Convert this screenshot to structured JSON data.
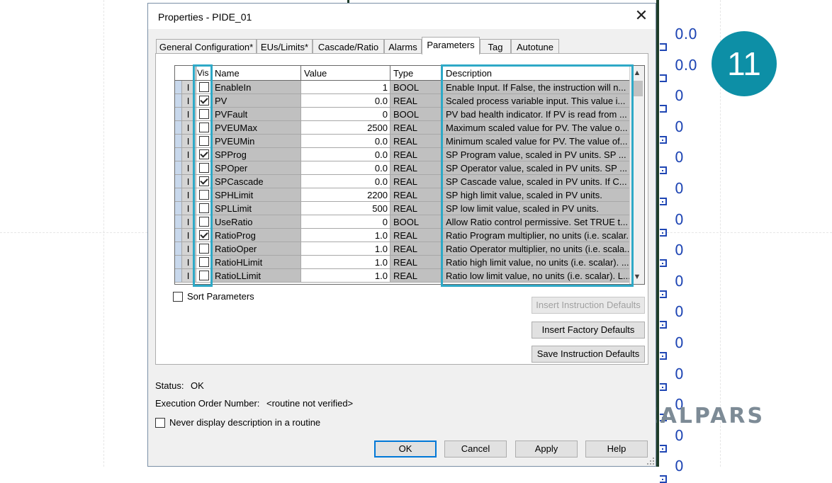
{
  "dialog": {
    "title": "Properties - PIDE_01",
    "close_glyph": "✕",
    "tabs": [
      {
        "label": "General Configuration*",
        "active": false
      },
      {
        "label": "EUs/Limits*",
        "active": false
      },
      {
        "label": "Cascade/Ratio",
        "active": false
      },
      {
        "label": "Alarms",
        "active": false
      },
      {
        "label": "Parameters",
        "active": true
      },
      {
        "label": "Tag",
        "active": false
      },
      {
        "label": "Autotune",
        "active": false
      }
    ],
    "grid": {
      "headers": {
        "vis": "Vis",
        "name": "Name",
        "value": "Value",
        "type": "Type",
        "description": "Description"
      },
      "rows": [
        {
          "io": "I",
          "visible": false,
          "name": "EnableIn",
          "value": "1",
          "type": "BOOL",
          "description": "Enable Input.  If False, the instruction will n..."
        },
        {
          "io": "I",
          "visible": true,
          "name": "PV",
          "value": "0.0",
          "type": "REAL",
          "description": "Scaled process variable input.  This value i..."
        },
        {
          "io": "I",
          "visible": false,
          "name": "PVFault",
          "value": "0",
          "type": "BOOL",
          "description": "PV bad health indicator.  If PV is read from ..."
        },
        {
          "io": "I",
          "visible": false,
          "name": "PVEUMax",
          "value": "2500",
          "type": "REAL",
          "description": "Maximum scaled value for PV.  The value o..."
        },
        {
          "io": "I",
          "visible": false,
          "name": "PVEUMin",
          "value": "0.0",
          "type": "REAL",
          "description": "Minimum scaled value for PV.  The value of..."
        },
        {
          "io": "I",
          "visible": true,
          "name": "SPProg",
          "value": "0.0",
          "type": "REAL",
          "description": " SP Program value, scaled in PV units.  SP ..."
        },
        {
          "io": "I",
          "visible": false,
          "name": "SPOper",
          "value": "0.0",
          "type": "REAL",
          "description": "SP Operator value, scaled in PV units.  SP ..."
        },
        {
          "io": "I",
          "visible": true,
          "name": "SPCascade",
          "value": "0.0",
          "type": "REAL",
          "description": "SP Cascade value, scaled in PV units.  If C..."
        },
        {
          "io": "I",
          "visible": false,
          "name": "SPHLimit",
          "value": "2200",
          "type": "REAL",
          "description": "SP high limit value, scaled in PV units."
        },
        {
          "io": "I",
          "visible": false,
          "name": "SPLLimit",
          "value": "500",
          "type": "REAL",
          "description": "SP low limit value, scaled in PV units."
        },
        {
          "io": "I",
          "visible": false,
          "name": "UseRatio",
          "value": "0",
          "type": "BOOL",
          "description": "Allow Ratio control permissive.  Set TRUE t..."
        },
        {
          "io": "I",
          "visible": true,
          "name": "RatioProg",
          "value": "1.0",
          "type": "REAL",
          "description": "Ratio Program multiplier, no units (i.e. scalar..."
        },
        {
          "io": "I",
          "visible": false,
          "name": "RatioOper",
          "value": "1.0",
          "type": "REAL",
          "description": "Ratio Operator multiplier, no units (i.e. scala..."
        },
        {
          "io": "I",
          "visible": false,
          "name": "RatioHLimit",
          "value": "1.0",
          "type": "REAL",
          "description": "Ratio high limit value, no units (i.e. scalar). ..."
        },
        {
          "io": "I",
          "visible": false,
          "name": "RatioLLimit",
          "value": "1.0",
          "type": "REAL",
          "description": "Ratio low limit value, no units (i.e. scalar).  L..."
        }
      ]
    },
    "sort_parameters": {
      "label": "Sort Parameters",
      "checked": false
    },
    "buttons": {
      "insert_instruction_defaults": "Insert Instruction Defaults",
      "insert_factory_defaults": "Insert Factory Defaults",
      "save_instruction_defaults": "Save Instruction Defaults",
      "ok": "OK",
      "cancel": "Cancel",
      "apply": "Apply",
      "help": "Help"
    },
    "status": {
      "label": "Status:",
      "value": "OK"
    },
    "execution_order": {
      "label": "Execution Order Number:",
      "value": "<routine not verified>"
    },
    "never_display": {
      "label": "Never display description in a routine",
      "checked": false
    }
  },
  "background": {
    "values": [
      "0.0",
      "0.0",
      "0",
      "0",
      "0",
      "0",
      "0",
      "0",
      "0",
      "0",
      "0",
      "0",
      "0",
      "0",
      "0"
    ],
    "badge_number": "11",
    "logo_left": "REALPARS",
    "logo_right": ""
  },
  "colors": {
    "highlight": "#2ea9c7",
    "badge": "#0d8fa6",
    "value_text": "#1f46b4"
  }
}
